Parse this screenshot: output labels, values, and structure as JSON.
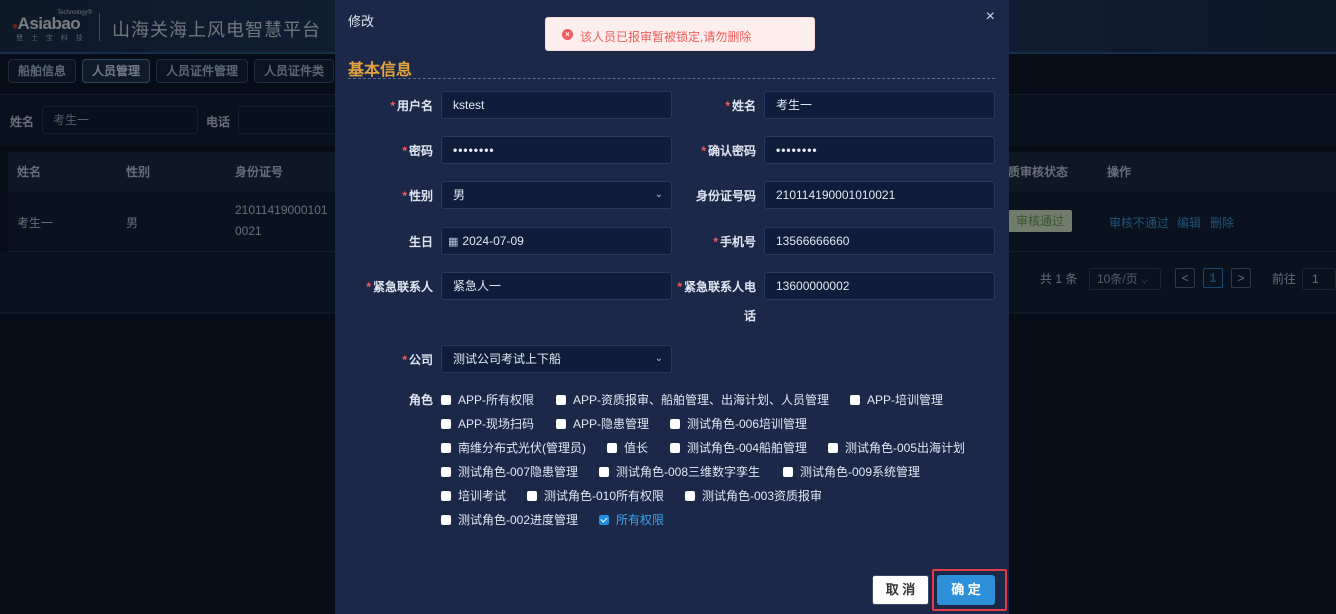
{
  "header": {
    "logo_tech": "Technology®",
    "logo_brand": "Asiabao",
    "logo_sub": "慧 士 宝 科 技",
    "system_title": "山海关海上风电智慧平台"
  },
  "nav_tabs": [
    "船舶信息",
    "人员管理",
    "人员证件管理",
    "人员证件类"
  ],
  "filter": {
    "name_label": "姓名",
    "name_value": "考生一",
    "phone_label": "电话"
  },
  "table": {
    "headers": {
      "name": "姓名",
      "gender": "性别",
      "id_no": "身份证号",
      "audit_status": "质审核状态",
      "ops": "操作"
    },
    "row": {
      "name": "考生一",
      "gender": "男",
      "id_line1": "21011419000101",
      "id_line2": "0021",
      "status": "审核通过",
      "op_reject": "审核不通过",
      "op_edit": "编辑",
      "op_delete": "删除"
    }
  },
  "pagination": {
    "total": "共 1 条",
    "page_size": "10条/页",
    "prev": "<",
    "current": "1",
    "next": ">",
    "goto_label": "前往",
    "goto_value": "1"
  },
  "dialog": {
    "title": "修改",
    "close": "×",
    "section_title": "基本信息",
    "fields": {
      "username_label": "用户名",
      "username_value": "kstest",
      "name_label": "姓名",
      "name_value": "考生一",
      "password_label": "密码",
      "password_value": "••••••••",
      "confirm_label": "确认密码",
      "confirm_value": "••••••••",
      "gender_label": "性别",
      "gender_value": "男",
      "id_label": "身份证号码",
      "id_value": "210114190001010021",
      "birthday_label": "生日",
      "birthday_value": "2024-07-09",
      "phone_label": "手机号",
      "phone_value": "13566666660",
      "emergency_label": "紧急联系人",
      "emergency_value": "紧急人一",
      "emergency_phone_label_1": "紧急联系人电",
      "emergency_phone_label_2": "话",
      "emergency_phone_value": "13600000002",
      "company_label": "公司",
      "company_value": "测试公司考试上下船",
      "role_label": "角色"
    },
    "roles": [
      {
        "label": "APP-所有权限",
        "checked": false
      },
      {
        "label": "APP-资质报审、船舶管理、出海计划、人员管理",
        "checked": false
      },
      {
        "label": "APP-培训管理",
        "checked": false
      },
      {
        "label": "APP-现场扫码",
        "checked": false
      },
      {
        "label": "APP-隐患管理",
        "checked": false
      },
      {
        "label": "测试角色-006培训管理",
        "checked": false
      },
      {
        "label": "南维分布式光伏(管理员)",
        "checked": false
      },
      {
        "label": "值长",
        "checked": false
      },
      {
        "label": "测试角色-004船舶管理",
        "checked": false
      },
      {
        "label": "测试角色-005出海计划",
        "checked": false
      },
      {
        "label": "测试角色-007隐患管理",
        "checked": false
      },
      {
        "label": "测试角色-008三维数字孪生",
        "checked": false
      },
      {
        "label": "测试角色-009系统管理",
        "checked": false
      },
      {
        "label": "培训考试",
        "checked": false
      },
      {
        "label": "测试角色-010所有权限",
        "checked": false
      },
      {
        "label": "测试角色-003资质报审",
        "checked": false
      },
      {
        "label": "测试角色-002进度管理",
        "checked": false
      },
      {
        "label": "所有权限",
        "checked": true
      }
    ],
    "cancel_label": "取 消",
    "ok_label": "确 定"
  },
  "toast": {
    "icon": "×",
    "message": "该人员已报审暂被锁定,请勿删除"
  },
  "colors": {
    "accent": "#2e90d8",
    "section_title": "#e3a23e",
    "required": "#ff5b5b",
    "error": "#f15c5c",
    "highlight_border": "#e23b4a"
  }
}
